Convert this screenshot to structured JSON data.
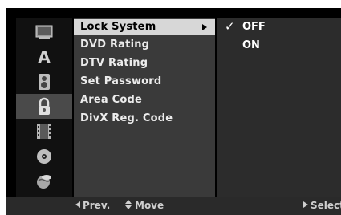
{
  "sidebar": {
    "icons": [
      {
        "name": "disc-tray-icon"
      },
      {
        "name": "language-icon",
        "glyph": "A"
      },
      {
        "name": "speaker-icon"
      },
      {
        "name": "lock-icon"
      },
      {
        "name": "film-icon"
      },
      {
        "name": "disc-icon"
      },
      {
        "name": "globe-icon"
      }
    ],
    "selected_index": 3
  },
  "menu": {
    "items": [
      "Lock System",
      "DVD Rating",
      "DTV Rating",
      "Set Password",
      "Area Code",
      "DivX Reg. Code"
    ],
    "active_index": 0
  },
  "options": {
    "items": [
      "OFF",
      "ON"
    ],
    "checked_index": 0,
    "check_glyph": "✓"
  },
  "statusbar": {
    "prev": "Prev.",
    "move": "Move",
    "select": "Select"
  }
}
